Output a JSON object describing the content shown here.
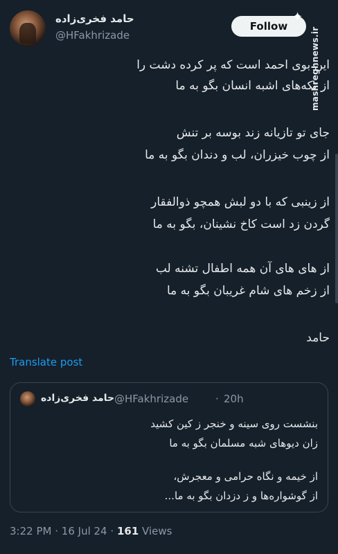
{
  "author": {
    "name": "حامد فخری‌زاده",
    "handle": "@HFakhrizade"
  },
  "follow_label": "Follow",
  "watermark": "mashreghnews.ir",
  "post": {
    "lines": [
      "این بوی احمد است که پر کرده دشت را",
      "از تکه‌های اشبه انسان بگو به ما",
      "جای تو تازیانه زند بوسه بر تنش",
      "از چوب خیزران، لب و دندان بگو به ما",
      "از زینبی که با دو لبش همچو ذوالفقار",
      "گردن زد است کاخ نشینان، بگو به ما",
      "از های های آن همه اطفال تشنه لب",
      "از زخم های شام غریبان بگو به ما",
      "حامد"
    ]
  },
  "translate_label": "Translate post",
  "quote": {
    "name": "حامد فخری‌زاده",
    "handle": "@HFakhrizade",
    "separator": "·",
    "time": "20h",
    "lines": [
      "بنشست روی سینه و خنجر ز کین کشید",
      "زان دیوهای شبه مسلمان بگو به ما",
      "از خیمه و نگاه حرامی و معجرش،",
      "از گوشواره‌ها و ز دزدان بگو به ما..."
    ]
  },
  "meta": {
    "time": "3:22 PM",
    "date": "16 Jul 24",
    "separator": "·",
    "views_count": "161",
    "views_label": "Views"
  }
}
